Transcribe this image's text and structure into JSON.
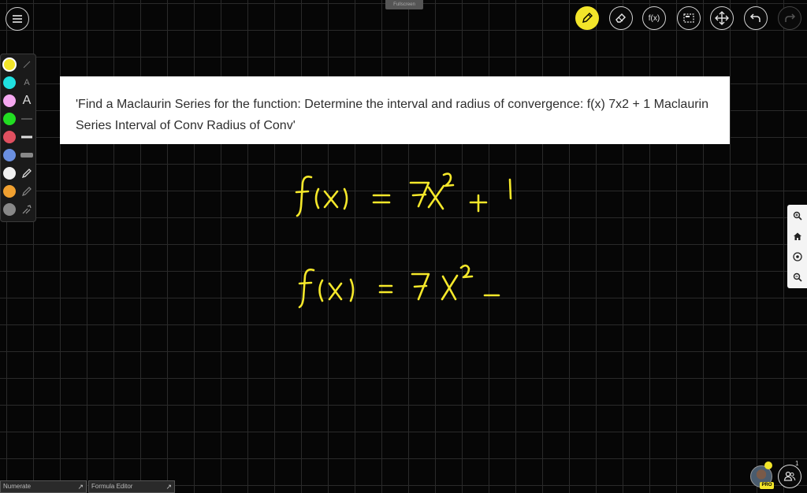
{
  "toolbar": {
    "fullscreen_label": "Fullscreen",
    "fx_label": "f(x)",
    "buttons": [
      "menu-icon",
      "pencil-icon",
      "eraser-icon",
      "function-icon",
      "select-box-icon",
      "move-icon",
      "undo-icon",
      "redo-icon"
    ]
  },
  "palette": {
    "colors": [
      "#f2e52a",
      "#20e0e0",
      "#f5a8f0",
      "#22dd22",
      "#e05060",
      "#6a8fe0",
      "#f0f0f0",
      "#f0a030",
      "#888888"
    ],
    "text_tool_label": "A",
    "text_tool_large_label": "A"
  },
  "question": {
    "text": "'Find a Maclaurin Series for the function: Determine the interval and radius of convergence: f(x) 7x2 + 1 Maclaurin Series Interval of Conv Radius of Conv'"
  },
  "handwriting": {
    "color": "#f5e82a",
    "line1": "f(x) = 7x² + 1",
    "line2": "f(x) = 7x² −"
  },
  "zoom_panel": [
    "zoom-in-icon",
    "home-icon",
    "target-icon",
    "zoom-out-icon"
  ],
  "bottom_panels": {
    "numerate_label": "Numerate",
    "formula_editor_label": "Formula Editor"
  },
  "user": {
    "badge": "PRO",
    "participant_count": "1"
  }
}
